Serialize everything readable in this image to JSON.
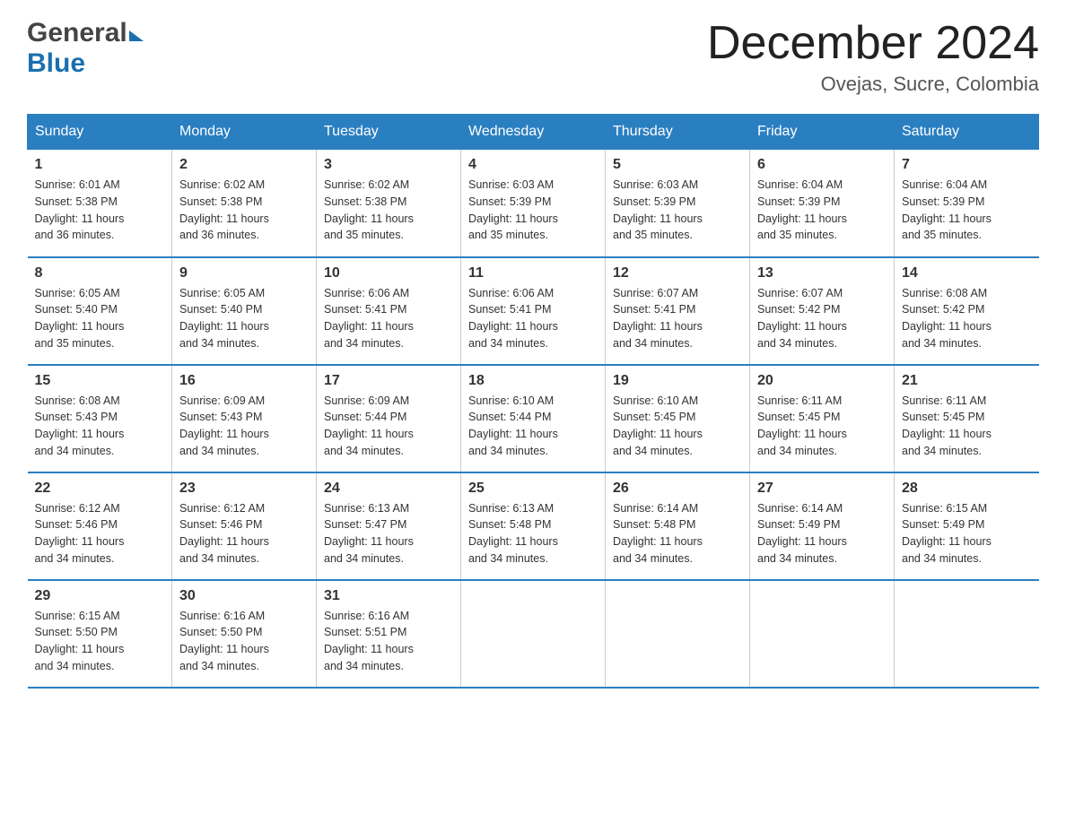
{
  "header": {
    "logo_general": "General",
    "logo_blue": "Blue",
    "month_year": "December 2024",
    "location": "Ovejas, Sucre, Colombia"
  },
  "days_of_week": [
    "Sunday",
    "Monday",
    "Tuesday",
    "Wednesday",
    "Thursday",
    "Friday",
    "Saturday"
  ],
  "weeks": [
    [
      {
        "day": "1",
        "sunrise": "6:01 AM",
        "sunset": "5:38 PM",
        "daylight": "11 hours and 36 minutes."
      },
      {
        "day": "2",
        "sunrise": "6:02 AM",
        "sunset": "5:38 PM",
        "daylight": "11 hours and 36 minutes."
      },
      {
        "day": "3",
        "sunrise": "6:02 AM",
        "sunset": "5:38 PM",
        "daylight": "11 hours and 35 minutes."
      },
      {
        "day": "4",
        "sunrise": "6:03 AM",
        "sunset": "5:39 PM",
        "daylight": "11 hours and 35 minutes."
      },
      {
        "day": "5",
        "sunrise": "6:03 AM",
        "sunset": "5:39 PM",
        "daylight": "11 hours and 35 minutes."
      },
      {
        "day": "6",
        "sunrise": "6:04 AM",
        "sunset": "5:39 PM",
        "daylight": "11 hours and 35 minutes."
      },
      {
        "day": "7",
        "sunrise": "6:04 AM",
        "sunset": "5:39 PM",
        "daylight": "11 hours and 35 minutes."
      }
    ],
    [
      {
        "day": "8",
        "sunrise": "6:05 AM",
        "sunset": "5:40 PM",
        "daylight": "11 hours and 35 minutes."
      },
      {
        "day": "9",
        "sunrise": "6:05 AM",
        "sunset": "5:40 PM",
        "daylight": "11 hours and 34 minutes."
      },
      {
        "day": "10",
        "sunrise": "6:06 AM",
        "sunset": "5:41 PM",
        "daylight": "11 hours and 34 minutes."
      },
      {
        "day": "11",
        "sunrise": "6:06 AM",
        "sunset": "5:41 PM",
        "daylight": "11 hours and 34 minutes."
      },
      {
        "day": "12",
        "sunrise": "6:07 AM",
        "sunset": "5:41 PM",
        "daylight": "11 hours and 34 minutes."
      },
      {
        "day": "13",
        "sunrise": "6:07 AM",
        "sunset": "5:42 PM",
        "daylight": "11 hours and 34 minutes."
      },
      {
        "day": "14",
        "sunrise": "6:08 AM",
        "sunset": "5:42 PM",
        "daylight": "11 hours and 34 minutes."
      }
    ],
    [
      {
        "day": "15",
        "sunrise": "6:08 AM",
        "sunset": "5:43 PM",
        "daylight": "11 hours and 34 minutes."
      },
      {
        "day": "16",
        "sunrise": "6:09 AM",
        "sunset": "5:43 PM",
        "daylight": "11 hours and 34 minutes."
      },
      {
        "day": "17",
        "sunrise": "6:09 AM",
        "sunset": "5:44 PM",
        "daylight": "11 hours and 34 minutes."
      },
      {
        "day": "18",
        "sunrise": "6:10 AM",
        "sunset": "5:44 PM",
        "daylight": "11 hours and 34 minutes."
      },
      {
        "day": "19",
        "sunrise": "6:10 AM",
        "sunset": "5:45 PM",
        "daylight": "11 hours and 34 minutes."
      },
      {
        "day": "20",
        "sunrise": "6:11 AM",
        "sunset": "5:45 PM",
        "daylight": "11 hours and 34 minutes."
      },
      {
        "day": "21",
        "sunrise": "6:11 AM",
        "sunset": "5:45 PM",
        "daylight": "11 hours and 34 minutes."
      }
    ],
    [
      {
        "day": "22",
        "sunrise": "6:12 AM",
        "sunset": "5:46 PM",
        "daylight": "11 hours and 34 minutes."
      },
      {
        "day": "23",
        "sunrise": "6:12 AM",
        "sunset": "5:46 PM",
        "daylight": "11 hours and 34 minutes."
      },
      {
        "day": "24",
        "sunrise": "6:13 AM",
        "sunset": "5:47 PM",
        "daylight": "11 hours and 34 minutes."
      },
      {
        "day": "25",
        "sunrise": "6:13 AM",
        "sunset": "5:48 PM",
        "daylight": "11 hours and 34 minutes."
      },
      {
        "day": "26",
        "sunrise": "6:14 AM",
        "sunset": "5:48 PM",
        "daylight": "11 hours and 34 minutes."
      },
      {
        "day": "27",
        "sunrise": "6:14 AM",
        "sunset": "5:49 PM",
        "daylight": "11 hours and 34 minutes."
      },
      {
        "day": "28",
        "sunrise": "6:15 AM",
        "sunset": "5:49 PM",
        "daylight": "11 hours and 34 minutes."
      }
    ],
    [
      {
        "day": "29",
        "sunrise": "6:15 AM",
        "sunset": "5:50 PM",
        "daylight": "11 hours and 34 minutes."
      },
      {
        "day": "30",
        "sunrise": "6:16 AM",
        "sunset": "5:50 PM",
        "daylight": "11 hours and 34 minutes."
      },
      {
        "day": "31",
        "sunrise": "6:16 AM",
        "sunset": "5:51 PM",
        "daylight": "11 hours and 34 minutes."
      },
      {
        "day": "",
        "sunrise": "",
        "sunset": "",
        "daylight": ""
      },
      {
        "day": "",
        "sunrise": "",
        "sunset": "",
        "daylight": ""
      },
      {
        "day": "",
        "sunrise": "",
        "sunset": "",
        "daylight": ""
      },
      {
        "day": "",
        "sunrise": "",
        "sunset": "",
        "daylight": ""
      }
    ]
  ],
  "labels": {
    "sunrise_prefix": "Sunrise: ",
    "sunset_prefix": "Sunset: ",
    "daylight_prefix": "Daylight: "
  }
}
